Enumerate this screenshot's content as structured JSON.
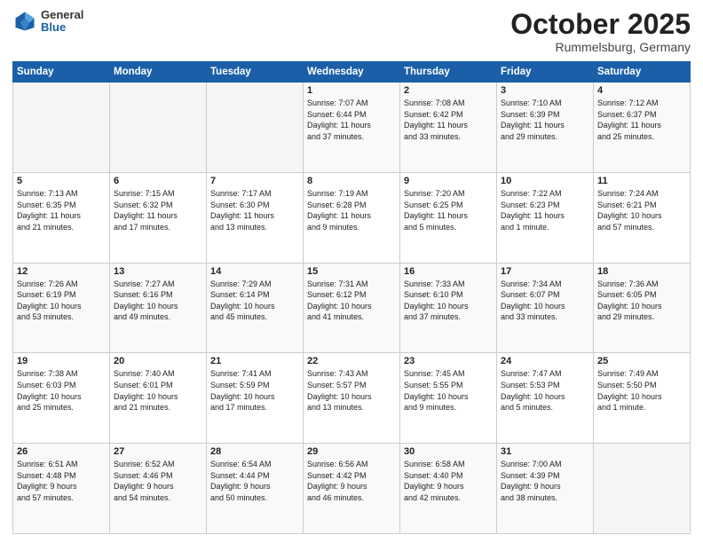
{
  "header": {
    "logo_general": "General",
    "logo_blue": "Blue",
    "month": "October 2025",
    "location": "Rummelsburg, Germany"
  },
  "days_of_week": [
    "Sunday",
    "Monday",
    "Tuesday",
    "Wednesday",
    "Thursday",
    "Friday",
    "Saturday"
  ],
  "weeks": [
    [
      {
        "day": "",
        "content": ""
      },
      {
        "day": "",
        "content": ""
      },
      {
        "day": "",
        "content": ""
      },
      {
        "day": "1",
        "content": "Sunrise: 7:07 AM\nSunset: 6:44 PM\nDaylight: 11 hours\nand 37 minutes."
      },
      {
        "day": "2",
        "content": "Sunrise: 7:08 AM\nSunset: 6:42 PM\nDaylight: 11 hours\nand 33 minutes."
      },
      {
        "day": "3",
        "content": "Sunrise: 7:10 AM\nSunset: 6:39 PM\nDaylight: 11 hours\nand 29 minutes."
      },
      {
        "day": "4",
        "content": "Sunrise: 7:12 AM\nSunset: 6:37 PM\nDaylight: 11 hours\nand 25 minutes."
      }
    ],
    [
      {
        "day": "5",
        "content": "Sunrise: 7:13 AM\nSunset: 6:35 PM\nDaylight: 11 hours\nand 21 minutes."
      },
      {
        "day": "6",
        "content": "Sunrise: 7:15 AM\nSunset: 6:32 PM\nDaylight: 11 hours\nand 17 minutes."
      },
      {
        "day": "7",
        "content": "Sunrise: 7:17 AM\nSunset: 6:30 PM\nDaylight: 11 hours\nand 13 minutes."
      },
      {
        "day": "8",
        "content": "Sunrise: 7:19 AM\nSunset: 6:28 PM\nDaylight: 11 hours\nand 9 minutes."
      },
      {
        "day": "9",
        "content": "Sunrise: 7:20 AM\nSunset: 6:25 PM\nDaylight: 11 hours\nand 5 minutes."
      },
      {
        "day": "10",
        "content": "Sunrise: 7:22 AM\nSunset: 6:23 PM\nDaylight: 11 hours\nand 1 minute."
      },
      {
        "day": "11",
        "content": "Sunrise: 7:24 AM\nSunset: 6:21 PM\nDaylight: 10 hours\nand 57 minutes."
      }
    ],
    [
      {
        "day": "12",
        "content": "Sunrise: 7:26 AM\nSunset: 6:19 PM\nDaylight: 10 hours\nand 53 minutes."
      },
      {
        "day": "13",
        "content": "Sunrise: 7:27 AM\nSunset: 6:16 PM\nDaylight: 10 hours\nand 49 minutes."
      },
      {
        "day": "14",
        "content": "Sunrise: 7:29 AM\nSunset: 6:14 PM\nDaylight: 10 hours\nand 45 minutes."
      },
      {
        "day": "15",
        "content": "Sunrise: 7:31 AM\nSunset: 6:12 PM\nDaylight: 10 hours\nand 41 minutes."
      },
      {
        "day": "16",
        "content": "Sunrise: 7:33 AM\nSunset: 6:10 PM\nDaylight: 10 hours\nand 37 minutes."
      },
      {
        "day": "17",
        "content": "Sunrise: 7:34 AM\nSunset: 6:07 PM\nDaylight: 10 hours\nand 33 minutes."
      },
      {
        "day": "18",
        "content": "Sunrise: 7:36 AM\nSunset: 6:05 PM\nDaylight: 10 hours\nand 29 minutes."
      }
    ],
    [
      {
        "day": "19",
        "content": "Sunrise: 7:38 AM\nSunset: 6:03 PM\nDaylight: 10 hours\nand 25 minutes."
      },
      {
        "day": "20",
        "content": "Sunrise: 7:40 AM\nSunset: 6:01 PM\nDaylight: 10 hours\nand 21 minutes."
      },
      {
        "day": "21",
        "content": "Sunrise: 7:41 AM\nSunset: 5:59 PM\nDaylight: 10 hours\nand 17 minutes."
      },
      {
        "day": "22",
        "content": "Sunrise: 7:43 AM\nSunset: 5:57 PM\nDaylight: 10 hours\nand 13 minutes."
      },
      {
        "day": "23",
        "content": "Sunrise: 7:45 AM\nSunset: 5:55 PM\nDaylight: 10 hours\nand 9 minutes."
      },
      {
        "day": "24",
        "content": "Sunrise: 7:47 AM\nSunset: 5:53 PM\nDaylight: 10 hours\nand 5 minutes."
      },
      {
        "day": "25",
        "content": "Sunrise: 7:49 AM\nSunset: 5:50 PM\nDaylight: 10 hours\nand 1 minute."
      }
    ],
    [
      {
        "day": "26",
        "content": "Sunrise: 6:51 AM\nSunset: 4:48 PM\nDaylight: 9 hours\nand 57 minutes."
      },
      {
        "day": "27",
        "content": "Sunrise: 6:52 AM\nSunset: 4:46 PM\nDaylight: 9 hours\nand 54 minutes."
      },
      {
        "day": "28",
        "content": "Sunrise: 6:54 AM\nSunset: 4:44 PM\nDaylight: 9 hours\nand 50 minutes."
      },
      {
        "day": "29",
        "content": "Sunrise: 6:56 AM\nSunset: 4:42 PM\nDaylight: 9 hours\nand 46 minutes."
      },
      {
        "day": "30",
        "content": "Sunrise: 6:58 AM\nSunset: 4:40 PM\nDaylight: 9 hours\nand 42 minutes."
      },
      {
        "day": "31",
        "content": "Sunrise: 7:00 AM\nSunset: 4:39 PM\nDaylight: 9 hours\nand 38 minutes."
      },
      {
        "day": "",
        "content": ""
      }
    ]
  ]
}
